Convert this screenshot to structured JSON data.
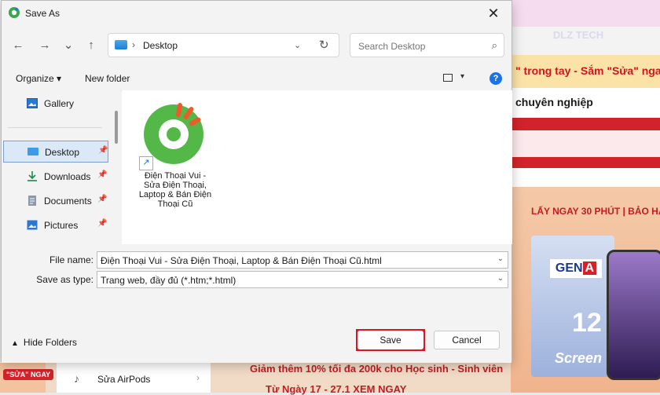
{
  "background": {
    "logo": "DLZ TECH",
    "banner_text": "\" trong tay - Sắm \"Sửa\" ngay!",
    "heading": "chuyên nghiệp",
    "promo_text": "LẤY NGAY 30 PHÚT | BẢO HÀ",
    "product_brand": "GEN",
    "product_brand_accent": "A",
    "product_model": "12",
    "product_label": "Screen",
    "badge": "\"SỬA\" NGAY",
    "side_menu_label": "Sửa AirPods",
    "bottom_promo": "Giảm thêm 10% tối đa 200k cho Học sinh - Sinh viên",
    "bottom_date": "Từ Ngày 17 - 27.1    XEM NGAY"
  },
  "dialog": {
    "title": "Save As",
    "close_glyph": "✕",
    "nav": {
      "back": "←",
      "forward": "→",
      "recent": "⌄",
      "up": "↑"
    },
    "address": {
      "separator": "›",
      "location": "Desktop",
      "dropdown": "⌄",
      "refresh": "↻"
    },
    "search": {
      "placeholder": "Search Desktop",
      "icon": "⌕"
    },
    "commands": {
      "organize": "Organize ▾",
      "new_folder": "New folder",
      "view_dropdown": "▾",
      "help": "?"
    },
    "sidebar": [
      {
        "label": "Gallery",
        "pinned": false,
        "icon": "gallery-icon"
      },
      {
        "label": "Desktop",
        "pinned": true,
        "icon": "desktop-icon",
        "selected": true
      },
      {
        "label": "Downloads",
        "pinned": true,
        "icon": "download-icon"
      },
      {
        "label": "Documents",
        "pinned": true,
        "icon": "documents-icon"
      },
      {
        "label": "Pictures",
        "pinned": true,
        "icon": "pictures-icon"
      }
    ],
    "pin_glyph": "📌",
    "files": [
      {
        "name": "Điện Thoại Vui - Sửa Điện Thoại, Laptop & Bán Điện Thoại Cũ",
        "icon": "coccoc-shortcut-icon",
        "shortcut_glyph": "↗"
      }
    ],
    "file_name_label": "File name:",
    "file_name_value": "Điện Thoại Vui - Sửa Điện Thoại, Laptop & Bán Điện Thoại Cũ.html",
    "save_type_label": "Save as type:",
    "save_type_value": "Trang web, đầy đủ (*.htm;*.html)",
    "dropdown_glyph": "⌄",
    "hide_folders": "Hide Folders",
    "hide_caret": "▲",
    "save_label": "Save",
    "cancel_label": "Cancel",
    "colors": {
      "accent": "#1a73e8",
      "highlight": "#e0141e",
      "brand_red": "#d2232a"
    }
  }
}
